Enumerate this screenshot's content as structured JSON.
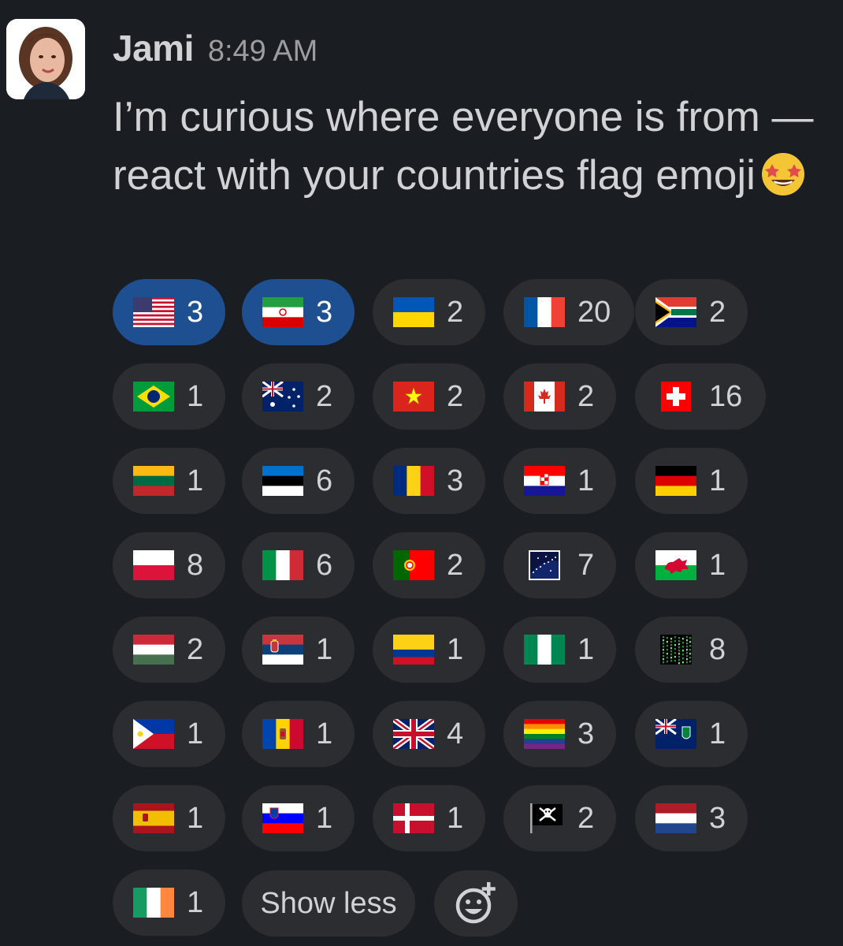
{
  "message": {
    "author": "Jami",
    "time": "8:49 AM",
    "text": "I’m curious where everyone is from — react with your countries flag emoji",
    "trailing_emoji": "star-struck"
  },
  "reactions": [
    {
      "emoji": "flag-us",
      "count": "3",
      "active": true
    },
    {
      "emoji": "flag-ir",
      "count": "3",
      "active": true
    },
    {
      "emoji": "flag-ua",
      "count": "2",
      "active": false
    },
    {
      "emoji": "flag-fr",
      "count": "20",
      "active": false
    },
    {
      "emoji": "flag-za",
      "count": "2",
      "active": false
    },
    {
      "emoji": "flag-br",
      "count": "1",
      "active": false
    },
    {
      "emoji": "flag-au",
      "count": "2",
      "active": false
    },
    {
      "emoji": "flag-vn",
      "count": "2",
      "active": false
    },
    {
      "emoji": "flag-ca",
      "count": "2",
      "active": false
    },
    {
      "emoji": "flag-ch",
      "count": "16",
      "active": false
    },
    {
      "emoji": "flag-lt",
      "count": "1",
      "active": false
    },
    {
      "emoji": "flag-ee",
      "count": "6",
      "active": false
    },
    {
      "emoji": "flag-ro",
      "count": "3",
      "active": false
    },
    {
      "emoji": "flag-hr",
      "count": "1",
      "active": false
    },
    {
      "emoji": "flag-de",
      "count": "1",
      "active": false
    },
    {
      "emoji": "flag-pl",
      "count": "8",
      "active": false
    },
    {
      "emoji": "flag-it",
      "count": "6",
      "active": false
    },
    {
      "emoji": "flag-pt",
      "count": "2",
      "active": false
    },
    {
      "emoji": "custom-night-sky",
      "count": "7",
      "active": false
    },
    {
      "emoji": "flag-wales",
      "count": "1",
      "active": false
    },
    {
      "emoji": "flag-hu",
      "count": "2",
      "active": false
    },
    {
      "emoji": "flag-rs",
      "count": "1",
      "active": false
    },
    {
      "emoji": "flag-co",
      "count": "1",
      "active": false
    },
    {
      "emoji": "flag-ng",
      "count": "1",
      "active": false
    },
    {
      "emoji": "custom-matrix",
      "count": "8",
      "active": false
    },
    {
      "emoji": "flag-ph",
      "count": "1",
      "active": false
    },
    {
      "emoji": "flag-md",
      "count": "1",
      "active": false
    },
    {
      "emoji": "flag-gb",
      "count": "4",
      "active": false
    },
    {
      "emoji": "rainbow-flag",
      "count": "3",
      "active": false
    },
    {
      "emoji": "flag-vg",
      "count": "1",
      "active": false
    },
    {
      "emoji": "flag-es",
      "count": "1",
      "active": false
    },
    {
      "emoji": "flag-si",
      "count": "1",
      "active": false
    },
    {
      "emoji": "flag-dk",
      "count": "1",
      "active": false
    },
    {
      "emoji": "pirate-flag",
      "count": "2",
      "active": false
    },
    {
      "emoji": "flag-nl",
      "count": "3",
      "active": false
    },
    {
      "emoji": "flag-ie",
      "count": "1",
      "active": false
    }
  ],
  "controls": {
    "show_less_label": "Show less",
    "add_reaction_icon": "add-reaction-icon"
  },
  "colors": {
    "background": "#1a1d21",
    "pill": "#2c2d30",
    "pill_active": "#1d4f91",
    "text": "#d1d2d3",
    "muted": "#9b9d9f"
  }
}
